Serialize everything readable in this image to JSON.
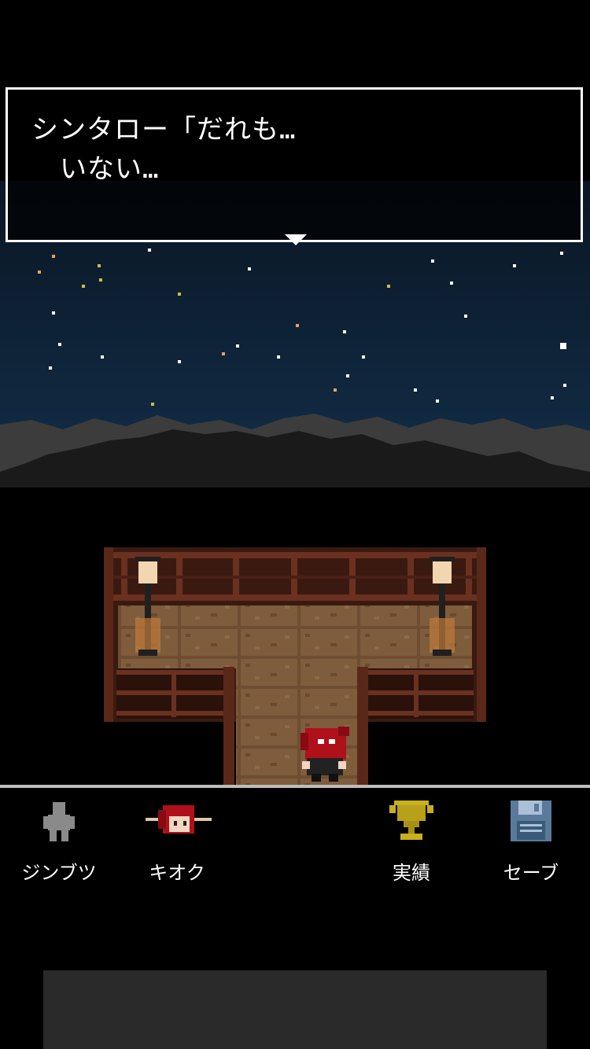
{
  "dialog": {
    "speaker_line": "シンタロー「だれも…",
    "second_line": "いない…"
  },
  "menu": {
    "characters_label": "ジンブツ",
    "memory_label": "キオク",
    "achievements_label": "実績",
    "save_label": "セーブ"
  },
  "colors": {
    "sky_top": "#0b1a2a",
    "sky_bottom": "#0d2238",
    "mountain": "#3a3a3a",
    "brick": "#7a5a3a",
    "wood": "#5a2a1a",
    "hair": "#b0101a"
  }
}
